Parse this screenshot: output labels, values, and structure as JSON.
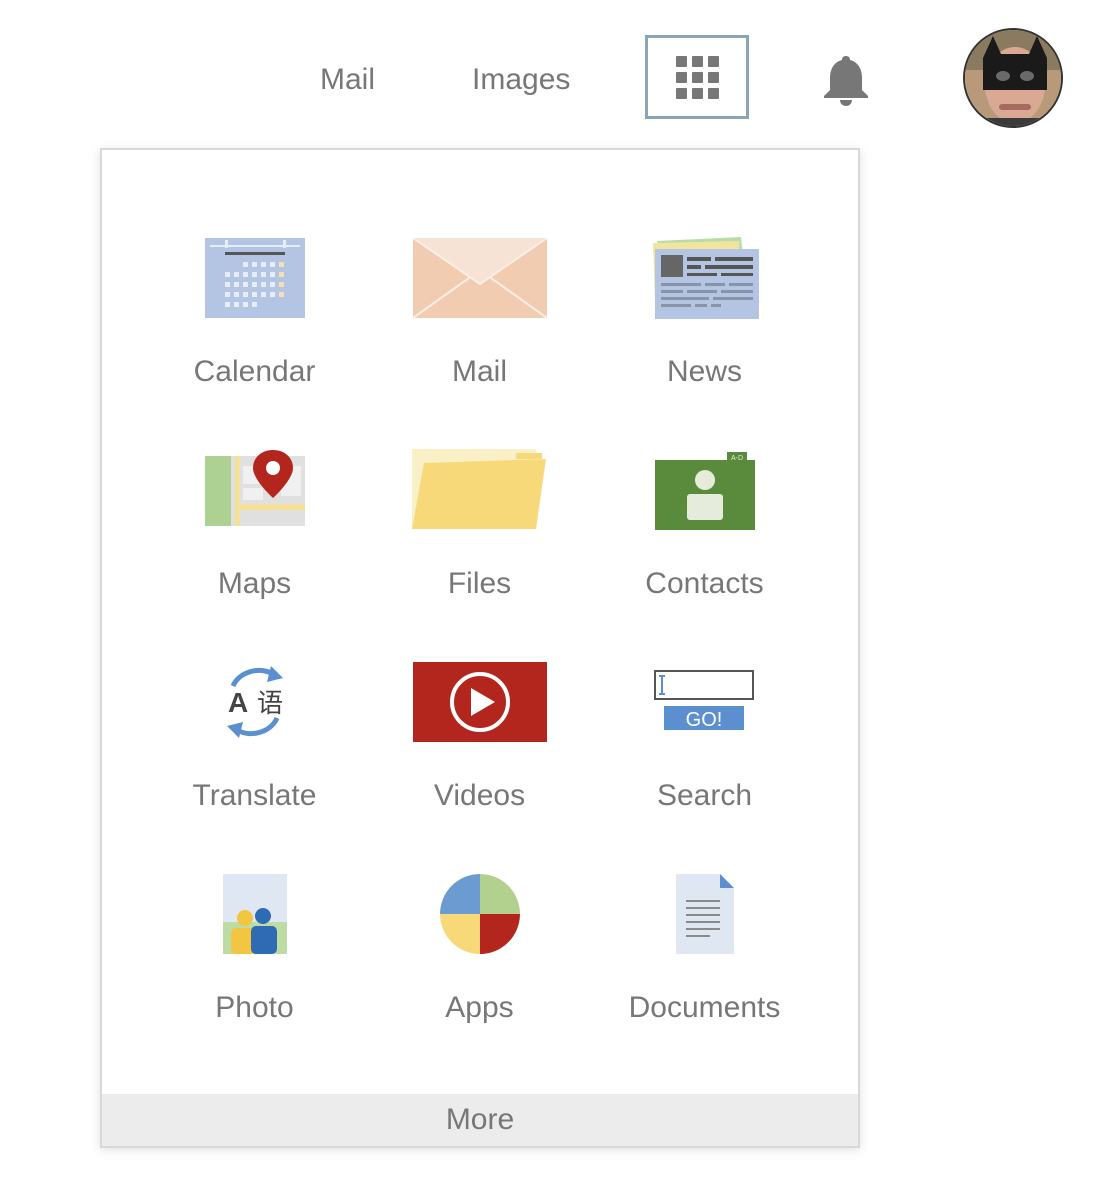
{
  "header": {
    "mail_label": "Mail",
    "images_label": "Images"
  },
  "apps": [
    {
      "label": "Calendar",
      "icon": "calendar-icon"
    },
    {
      "label": "Mail",
      "icon": "mail-icon"
    },
    {
      "label": "News",
      "icon": "news-icon"
    },
    {
      "label": "Maps",
      "icon": "maps-icon"
    },
    {
      "label": "Files",
      "icon": "folder-icon"
    },
    {
      "label": "Contacts",
      "icon": "contacts-icon"
    },
    {
      "label": "Translate",
      "icon": "translate-icon"
    },
    {
      "label": "Videos",
      "icon": "video-play-icon"
    },
    {
      "label": "Search",
      "icon": "search-box-icon"
    },
    {
      "label": "Photo",
      "icon": "photo-icon"
    },
    {
      "label": "Apps",
      "icon": "apps-pie-icon"
    },
    {
      "label": "Documents",
      "icon": "document-icon"
    }
  ],
  "icon_text": {
    "contacts_tab": "A-D",
    "translate_latin": "A",
    "translate_chinese": "语",
    "search_button": "GO!"
  },
  "more_label": "More",
  "colors": {
    "text": "#777777",
    "apps_button_border": "#8aa6b5",
    "video_red": "#b3261e",
    "contacts_green": "#5a8a3c",
    "search_blue": "#5b8fd0"
  }
}
